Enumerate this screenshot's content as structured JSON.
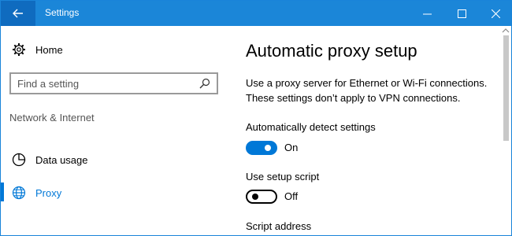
{
  "window": {
    "title": "Settings",
    "accent_color": "#1b86d8"
  },
  "sidebar": {
    "home_label": "Home",
    "search": {
      "placeholder": "Find a setting",
      "value": ""
    },
    "section_label": "Network & Internet",
    "items": [
      {
        "label": "Data usage",
        "icon": "data-usage-icon",
        "active": false
      },
      {
        "label": "Proxy",
        "icon": "globe-icon",
        "active": true
      }
    ]
  },
  "main": {
    "title": "Automatic proxy setup",
    "description": "Use a proxy server for Ethernet or Wi-Fi connections. These settings don’t apply to VPN connections.",
    "auto_detect": {
      "label": "Automatically detect settings",
      "state": "On",
      "on": true
    },
    "setup_script": {
      "label": "Use setup script",
      "state": "Off",
      "on": false
    },
    "script_address_label": "Script address"
  }
}
